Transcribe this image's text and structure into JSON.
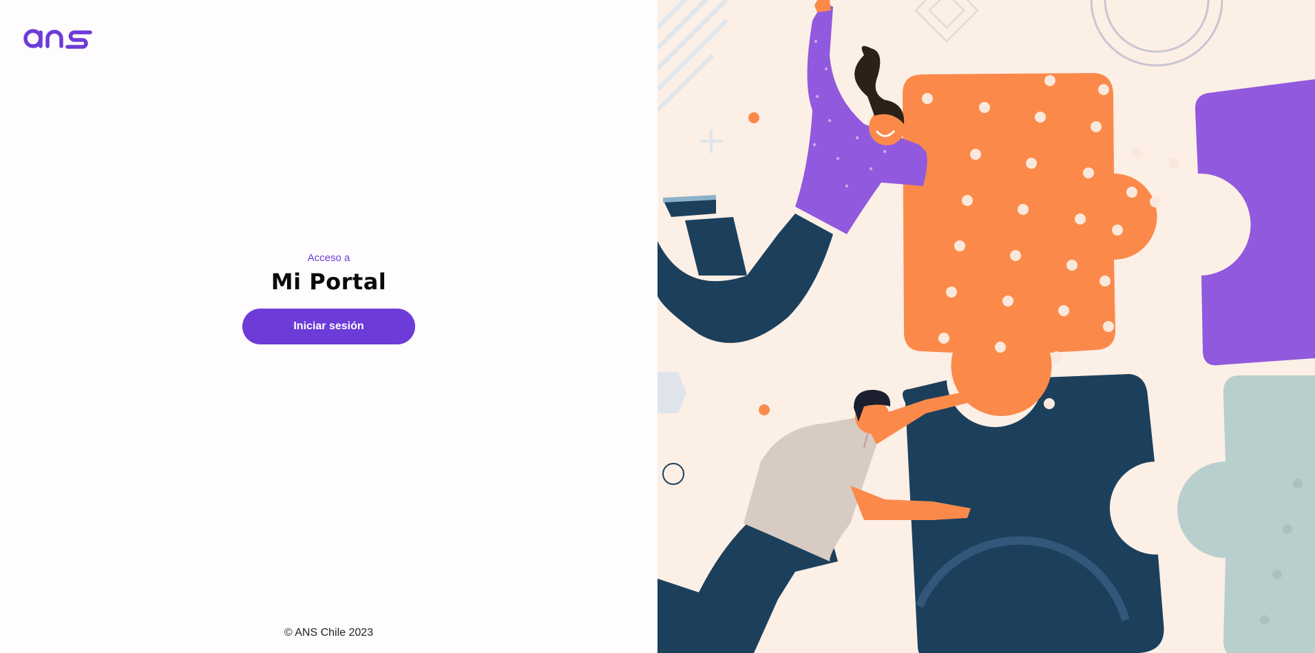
{
  "brand": {
    "logo_text": "ans",
    "accent_color": "#6c3bd8"
  },
  "login": {
    "subtitle": "Acceso a",
    "title": "Mi Portal",
    "button_label": "Iniciar sesión"
  },
  "footer": {
    "copyright": "© ANS Chile 2023"
  },
  "illustration": {
    "description_icon": "puzzle-teamwork-illustration",
    "colors": {
      "background": "#fcefe6",
      "orange": "#fb8a4a",
      "purple": "#9159dd",
      "navy": "#1c405c",
      "sage": "#b9cfcd",
      "dots": "#fbe8dc"
    }
  }
}
